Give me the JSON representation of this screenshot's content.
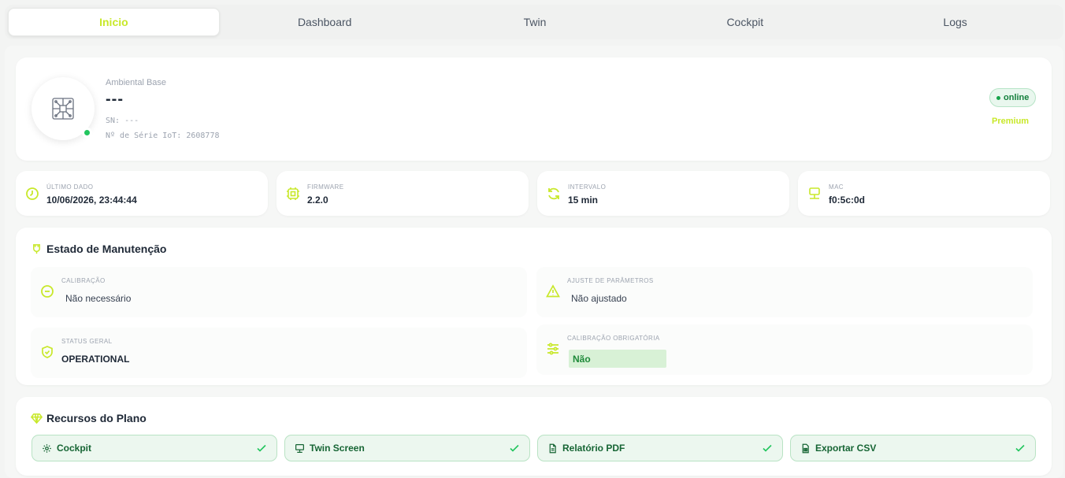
{
  "tabs": [
    {
      "label": "Inicio",
      "active": true
    },
    {
      "label": "Dashboard",
      "active": false
    },
    {
      "label": "Twin",
      "active": false
    },
    {
      "label": "Cockpit",
      "active": false
    },
    {
      "label": "Logs",
      "active": false
    }
  ],
  "device": {
    "model": "Ambiental Base",
    "name": "---",
    "sn": "SN: ---",
    "iot_serial": "Nº de Série IoT: 2608778",
    "status": "online",
    "plan": "Premium"
  },
  "info": [
    {
      "label": "Último Dado",
      "value": "10/06/2026, 23:44:44",
      "icon": "clock-icon"
    },
    {
      "label": "Firmware",
      "value": "2.2.0",
      "icon": "chip-icon"
    },
    {
      "label": "Intervalo",
      "value": "15 min",
      "icon": "refresh-icon"
    },
    {
      "label": "MAC",
      "value": "f0:5c:0d",
      "icon": "network-icon"
    }
  ],
  "maintenance": {
    "title": "Estado de Manutenção",
    "calibration": {
      "label": "Calibração",
      "value": "Não necessário"
    },
    "adjust": {
      "label": "Ajuste de Parâmetros",
      "value": "Não ajustado"
    },
    "status": {
      "label": "Status Geral",
      "value": "OPERATIONAL"
    },
    "mandatory": {
      "label": "Calibração Obrigatória",
      "value": "Não"
    }
  },
  "plan_resources": {
    "title": "Recursos do Plano",
    "items": [
      {
        "label": "Cockpit",
        "icon": "gear-icon"
      },
      {
        "label": "Twin Screen",
        "icon": "monitor-icon"
      },
      {
        "label": "Relatório PDF",
        "icon": "document-icon"
      },
      {
        "label": "Exportar CSV",
        "icon": "spreadsheet-icon"
      }
    ]
  },
  "colors": {
    "accent": "#c8e82a",
    "online": "#16a34a",
    "resource_bg": "#ecf7ef"
  }
}
